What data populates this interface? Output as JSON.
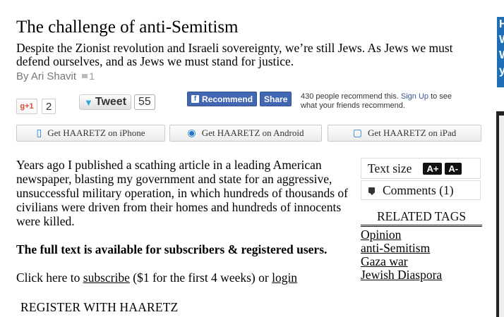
{
  "article": {
    "title": "The challenge of anti-Semitism",
    "subtitle": "Despite the Zionist revolution and Israeli sovereignty, we’re still Jews. As Jews we must defend ourselves, and as Jews we must stand for justice.",
    "byline": "By Ari Shavit",
    "comment_count": "1",
    "body": "Years ago I published a scathing article in a leading American newspaper, blasting my government and state for an aggressive, unsuccessful military operation, in which hundreds of thousands of civilians were driven from their homes and hundreds of innocents were killed.",
    "subscribe_notice": "The full text is available for subscribers & registered users.",
    "subscribe_prefix": "Click here to ",
    "subscribe_link": "subscribe",
    "subscribe_middle": " ($1 for the first 4 weeks) or ",
    "login_link": "login",
    "register": "REGISTER WITH HAARETZ"
  },
  "social": {
    "gplus_label": "g+1",
    "gplus_count": "2",
    "tweet_label": "Tweet",
    "tweet_count": "55",
    "fb_recommend": "Recommend",
    "fb_share": "Share",
    "fb_text_prefix": "430 people recommend this. ",
    "fb_signup": "Sign Up",
    "fb_text_suffix": " to see what your friends recommend."
  },
  "apps": {
    "iphone": "Get HAARETZ on iPhone",
    "android": "Get HAARETZ on Android",
    "ipad": "Get HAARETZ on iPad"
  },
  "sidebar": {
    "text_size_label": "Text size",
    "increase": "A+",
    "decrease": "A-",
    "comments": "Comments (1)",
    "related_tags_heading": "RELATED TAGS",
    "tags": [
      "Opinion",
      "anti-Semitism",
      "Gaza war",
      "Jewish Diaspora"
    ]
  },
  "edge": {
    "letters": [
      "H",
      "W",
      "W",
      "y"
    ]
  },
  "colors": {
    "facebook": "#4267b2",
    "twitter": "#2ea7e0",
    "gplus": "#dd4b39",
    "app_icon": "#1f77c9",
    "edge_ad": "#1e6fb6"
  }
}
